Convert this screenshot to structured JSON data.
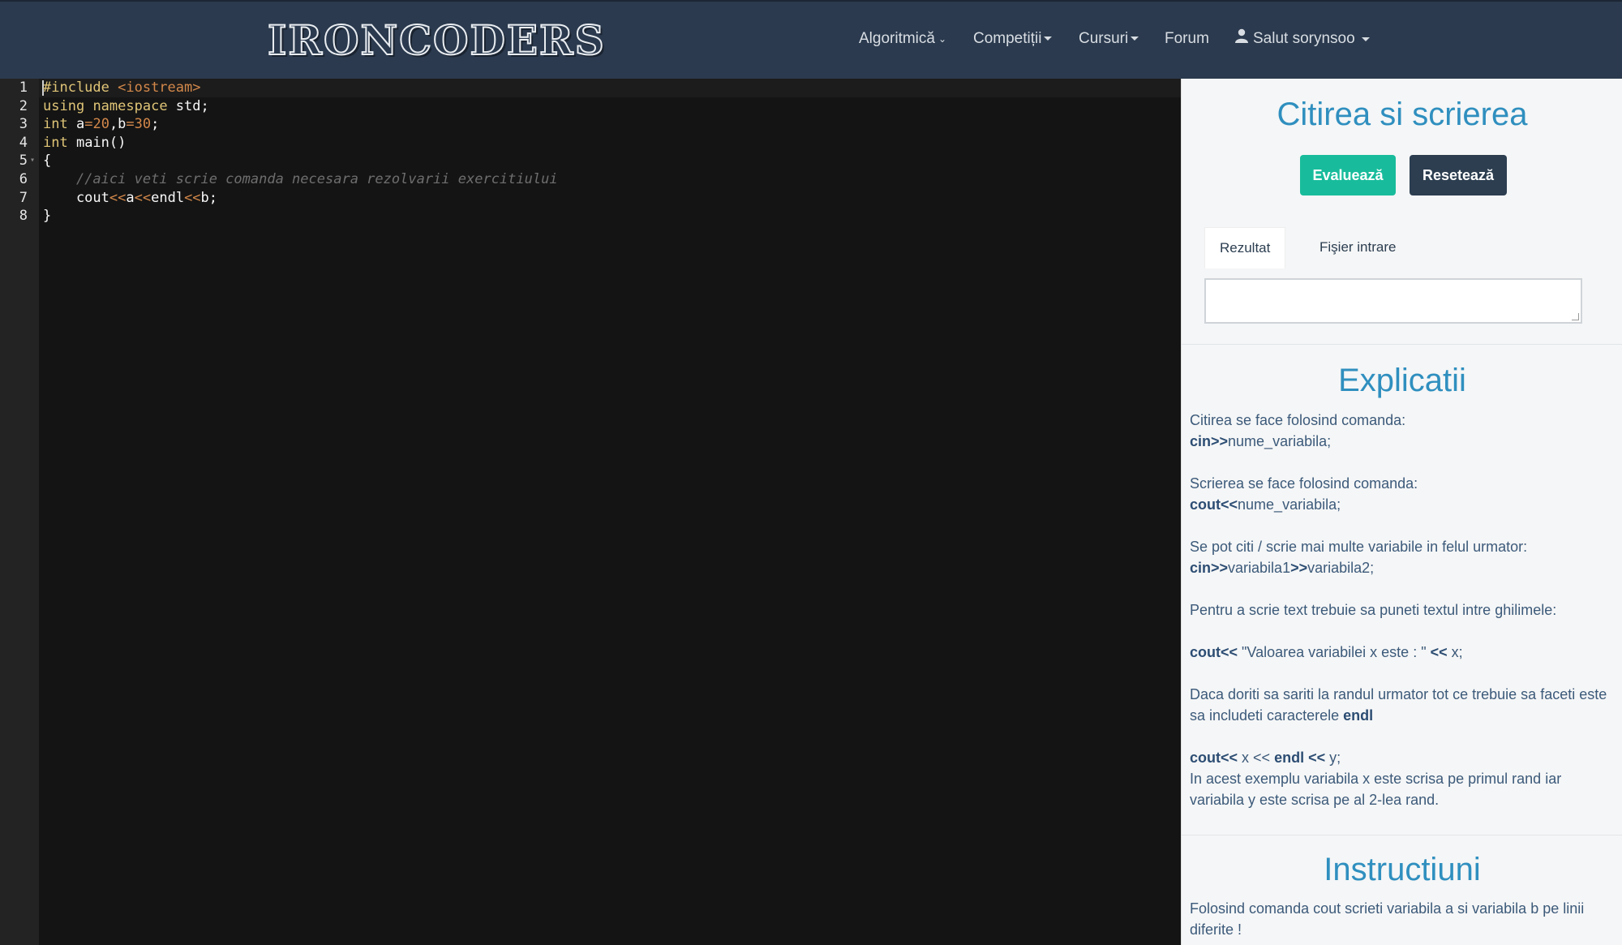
{
  "navbar": {
    "logo": "IRONCODERS",
    "items": [
      {
        "label": "Algoritmică"
      },
      {
        "label": "Competiții"
      },
      {
        "label": "Cursuri"
      },
      {
        "label": "Forum"
      },
      {
        "label": "Salut sorynsoo"
      }
    ]
  },
  "editor": {
    "line_numbers": [
      "1",
      "2",
      "3",
      "4",
      "5",
      "6",
      "7",
      "8"
    ],
    "lines": [
      "#include <iostream>",
      "using namespace std;",
      "int a=20,b=30;",
      "int main()",
      "{",
      "    //aici veti scrie comanda necesara rezolvarii exercitiului",
      "    cout<<a<<endl<<b;",
      "}"
    ]
  },
  "panel": {
    "title": "Citirea si scrierea",
    "evaluate_label": "Evaluează",
    "reset_label": "Resetează",
    "tabs": [
      {
        "label": "Rezultat"
      },
      {
        "label": "Fişier intrare"
      }
    ],
    "result_value": "",
    "explanations": {
      "heading": "Explicatii",
      "p1_text": "Citirea se face folosind comanda:",
      "p1_code_bold": "cin>>",
      "p1_code_rest": "nume_variabila;",
      "p2_text": "Scrierea se face folosind comanda:",
      "p2_code_bold": "cout<<",
      "p2_code_rest": "nume_variabila;",
      "p3_text": "Se pot citi / scrie mai multe variabile in felul urmator:",
      "p3_b1": "cin>>",
      "p3_r1": "variabila1",
      "p3_b2": ">>",
      "p3_r2": "variabila2;",
      "p4_text": "Pentru a scrie text trebuie sa puneti textul intre ghilimele:",
      "p5_b1": "cout<<",
      "p5_r1": " \"Valoarea variabilei x este : \" ",
      "p5_b2": "<<",
      "p5_r2": " x;",
      "p6_text": "Daca doriti sa sariti la randul urmator tot ce trebuie sa faceti este sa includeti caracterele ",
      "p6_bold": "endl",
      "p7_b1": "cout<<",
      "p7_r1": " x << ",
      "p7_b2": "endl",
      "p7_r2": " ",
      "p7_b3": "<<",
      "p7_r3": " y;",
      "p7_text": "In acest exemplu variabila x este scrisa pe primul rand iar variabila y este scrisa pe al 2-lea rand."
    },
    "instructions": {
      "heading": "Instructiuni",
      "text": "Folosind comanda cout scrieti variabila a si variabila b pe linii diferite !"
    }
  }
}
